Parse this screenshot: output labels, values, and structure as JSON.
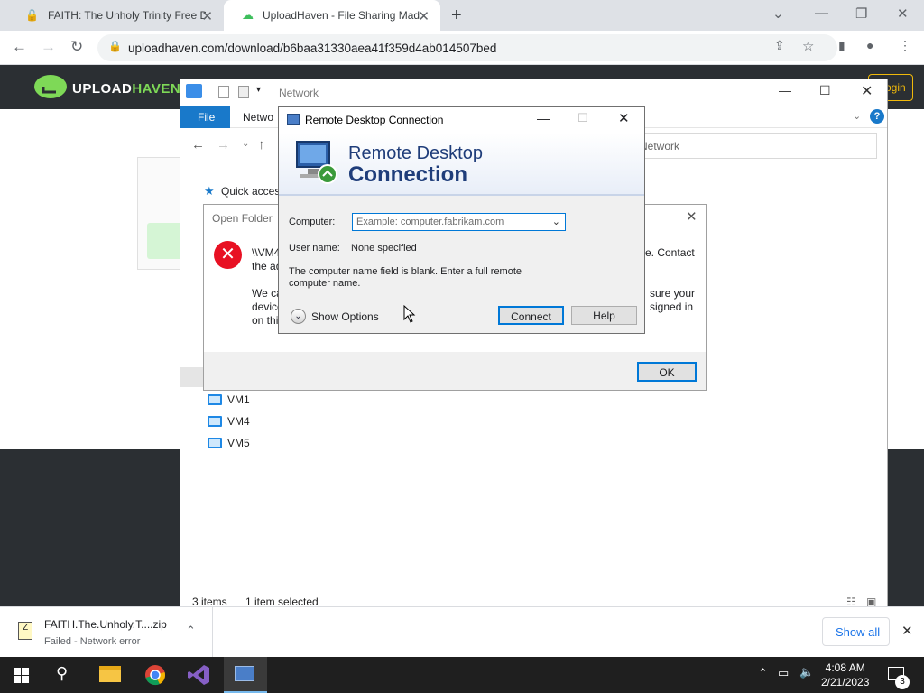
{
  "browser": {
    "tabs": [
      {
        "label": "FAITH: The Unholy Trinity Free Do"
      },
      {
        "label": "UploadHaven - File Sharing Made"
      }
    ],
    "url": "uploadhaven.com/download/b6baa31330aea41f359d4ab014507bed"
  },
  "site": {
    "logo": {
      "part1": "UPLOAD",
      "part2": "HAVEN"
    },
    "login_label": "ogin"
  },
  "explorer": {
    "title": "Network",
    "ribbon_tabs": [
      "File",
      "Netwo"
    ],
    "address": "Network",
    "quick_access": "Quick acces",
    "items": [
      {
        "name": "VM1"
      },
      {
        "name": "VM4"
      },
      {
        "name": "VM5"
      }
    ],
    "status_count": "3 items",
    "status_selected": "1 item selected"
  },
  "open_folder": {
    "title": "Open Folder",
    "line1a": "\\\\VM4",
    "line1b": "e. Contact",
    "line2": "the ad",
    "line3a": "We ca",
    "line3b": "sure your",
    "line4a": "device",
    "line4b": "signed in",
    "line5": "on thi",
    "ok_label": "OK"
  },
  "rdc": {
    "title": "Remote Desktop Connection",
    "banner_line1": "Remote Desktop",
    "banner_line2": "Connection",
    "computer_label": "Computer:",
    "computer_placeholder": "Example: computer.fabrikam.com",
    "username_label": "User name:",
    "username_value": "None specified",
    "message": "The computer name field is blank. Enter a full remote computer name.",
    "show_options": "Show Options",
    "connect_label": "Connect",
    "help_label": "Help"
  },
  "download": {
    "filename": "FAITH.The.Unholy.T....zip",
    "status": "Failed - Network error",
    "show_all": "Show all"
  },
  "taskbar": {
    "time": "4:08 AM",
    "date": "2/21/2023",
    "notifications": "3"
  }
}
